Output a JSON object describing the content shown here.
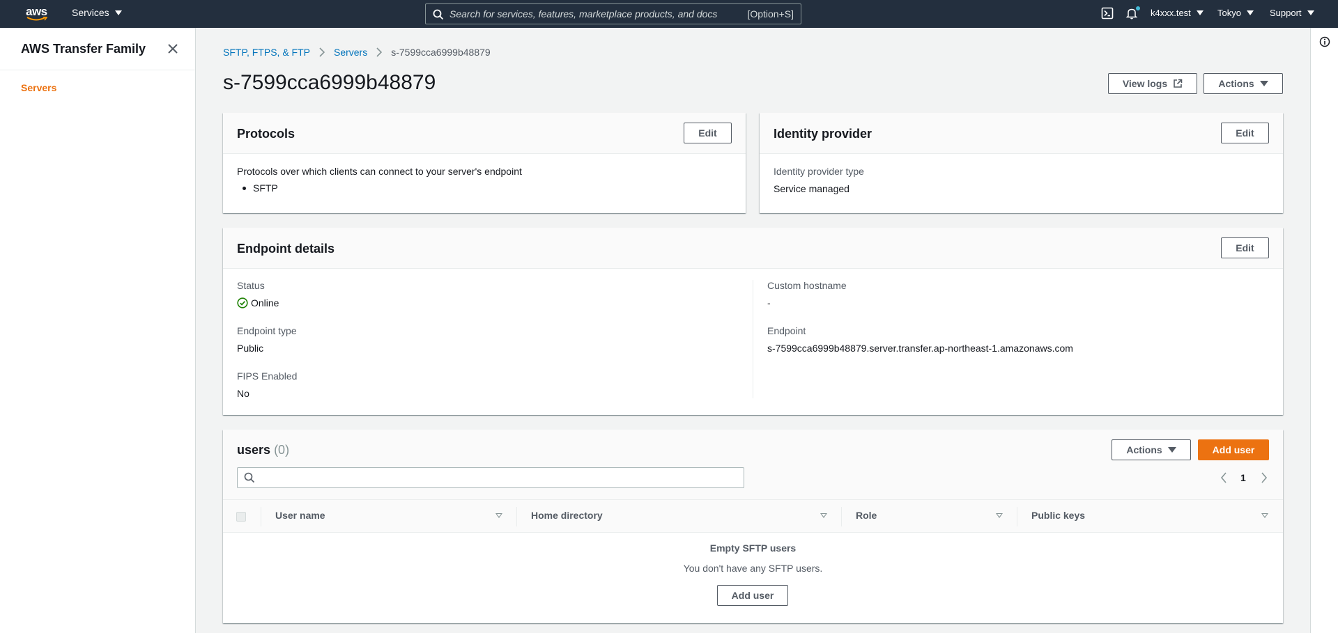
{
  "topnav": {
    "logo_text": "aws",
    "services_label": "Services",
    "search_placeholder": "Search for services, features, marketplace products, and docs",
    "search_shortcut": "[Option+S]",
    "account": "k4xxx.test",
    "region": "Tokyo",
    "support": "Support"
  },
  "sidenav": {
    "title": "AWS Transfer Family",
    "items": [
      {
        "label": "Servers"
      }
    ]
  },
  "breadcrumb": [
    "SFTP, FTPS, & FTP",
    "Servers",
    "s-7599cca6999b48879"
  ],
  "page": {
    "title": "s-7599cca6999b48879",
    "view_logs_label": "View logs",
    "actions_label": "Actions"
  },
  "protocols": {
    "title": "Protocols",
    "edit_label": "Edit",
    "description": "Protocols over which clients can connect to your server's endpoint",
    "list": [
      "SFTP"
    ]
  },
  "identity": {
    "title": "Identity provider",
    "edit_label": "Edit",
    "type_label": "Identity provider type",
    "type_value": "Service managed"
  },
  "endpoint": {
    "title": "Endpoint details",
    "edit_label": "Edit",
    "status_label": "Status",
    "status_value": "Online",
    "endpoint_type_label": "Endpoint type",
    "endpoint_type_value": "Public",
    "fips_label": "FIPS Enabled",
    "fips_value": "No",
    "custom_hostname_label": "Custom hostname",
    "custom_hostname_value": "-",
    "endpoint_label": "Endpoint",
    "endpoint_value": "s-7599cca6999b48879.server.transfer.ap-northeast-1.amazonaws.com"
  },
  "users": {
    "title": "users",
    "count": "(0)",
    "actions_label": "Actions",
    "add_user_label": "Add user",
    "page_number": "1",
    "columns": [
      "User name",
      "Home directory",
      "Role",
      "Public keys"
    ],
    "empty_title": "Empty SFTP users",
    "empty_message": "You don't have any SFTP users.",
    "empty_add_user_label": "Add user"
  },
  "colors": {
    "nav_bg": "#232f3e",
    "accent": "#ec7211",
    "link": "#0073bb",
    "success": "#1d8102"
  }
}
